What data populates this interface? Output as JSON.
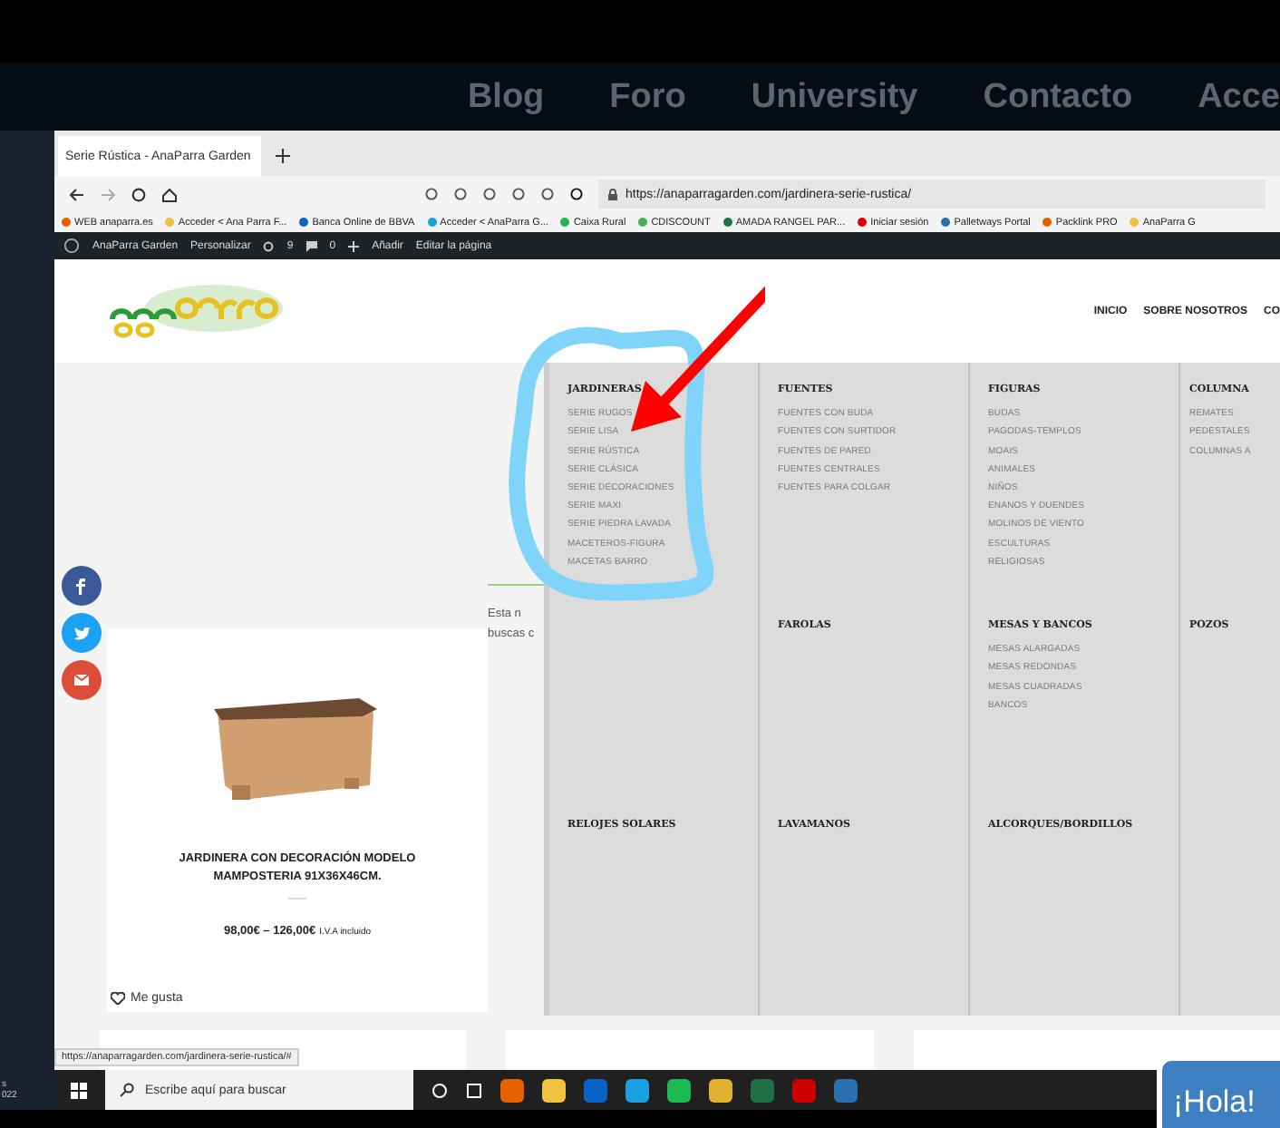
{
  "site_nav": [
    "Blog",
    "Foro",
    "University",
    "Contacto",
    "Acce"
  ],
  "browser": {
    "tab": "Serie Rústica - AnaParra Garden",
    "url": "https://anaparragarden.com/jardinera-serie-rustica/",
    "status_url": "https://anaparragarden.com/jardinera-serie-rustica/#",
    "bookmarks": [
      "WEB anaparra.es",
      "Acceder < Ana Parra F...",
      "Banca Online de BBVA",
      "Acceder < AnaParra G...",
      "Caixa Rural",
      "CDISCOUNT",
      "AMADA RANGEL PAR...",
      "Iniciar sesión",
      "Palletways Portal",
      "Packlink PRO",
      "AnaParra G"
    ]
  },
  "admin_bar": {
    "site": "AnaParra Garden",
    "customize": "Personalizar",
    "updates": "9",
    "comments": "0",
    "add": "Añadir",
    "edit": "Editar la página"
  },
  "header": {
    "nav": [
      "INICIO",
      "SOBRE NOSOTROS",
      "CO"
    ]
  },
  "intro": [
    "Esta n",
    "buscas c"
  ],
  "mega_menu": {
    "rows": [
      [
        {
          "heading": "JARDINERAS",
          "items": [
            "SERIE RUGOS",
            "SERIE LISA",
            "SERIE RÚSTICA",
            "SERIE CLÁSICA",
            "SERIE DECORACIONES",
            "SERIE MAXI",
            "SERIE PIEDRA LAVADA",
            "MACETEROS-FIGURA",
            "MACETAS BARRO"
          ]
        },
        {
          "heading": "FUENTES",
          "items": [
            "FUENTES CON BUDA",
            "FUENTES CON SURTIDOR",
            "FUENTES DE PARED",
            "FUENTES CENTRALES",
            "FUENTES PARA COLGAR"
          ]
        },
        {
          "heading": "FIGURAS",
          "items": [
            "BUDAS",
            "PAGODAS-TEMPLOS",
            "MOAIS",
            "ANIMALES",
            "NIÑOS",
            "ENANOS Y DUENDES",
            "MOLINOS DE VIENTO",
            "ESCULTURAS",
            "RELIGIOSAS"
          ]
        },
        {
          "heading": "COLUMNA",
          "items": [
            "REMATES",
            "PEDESTALES",
            "COLUMNAS A"
          ]
        }
      ],
      [
        null,
        {
          "heading": "FAROLAS"
        },
        {
          "heading": "MESAS Y BANCOS",
          "items": [
            "MESAS ALARGADAS",
            "MESAS REDONDAS",
            "MESAS CUADRADAS",
            "BANCOS"
          ]
        },
        {
          "heading": "POZOS"
        }
      ],
      [
        {
          "heading": "RELOJES SOLARES"
        },
        {
          "heading": "LAVAMANOS"
        },
        {
          "heading": "ALCORQUES/BORDILLOS"
        },
        null
      ]
    ]
  },
  "product": {
    "title": "JARDINERA CON DECORACIÓN MODELO MAMPOSTERIA 91X36X46CM.",
    "price": "98,00€ – 126,00€",
    "tax": "I.V.A incluido",
    "like": "Me gusta"
  },
  "taskbar": {
    "search_placeholder": "Escribe aquí para buscar"
  },
  "clock_fragment": [
    "s",
    "022"
  ],
  "chat": "¡Hola!"
}
